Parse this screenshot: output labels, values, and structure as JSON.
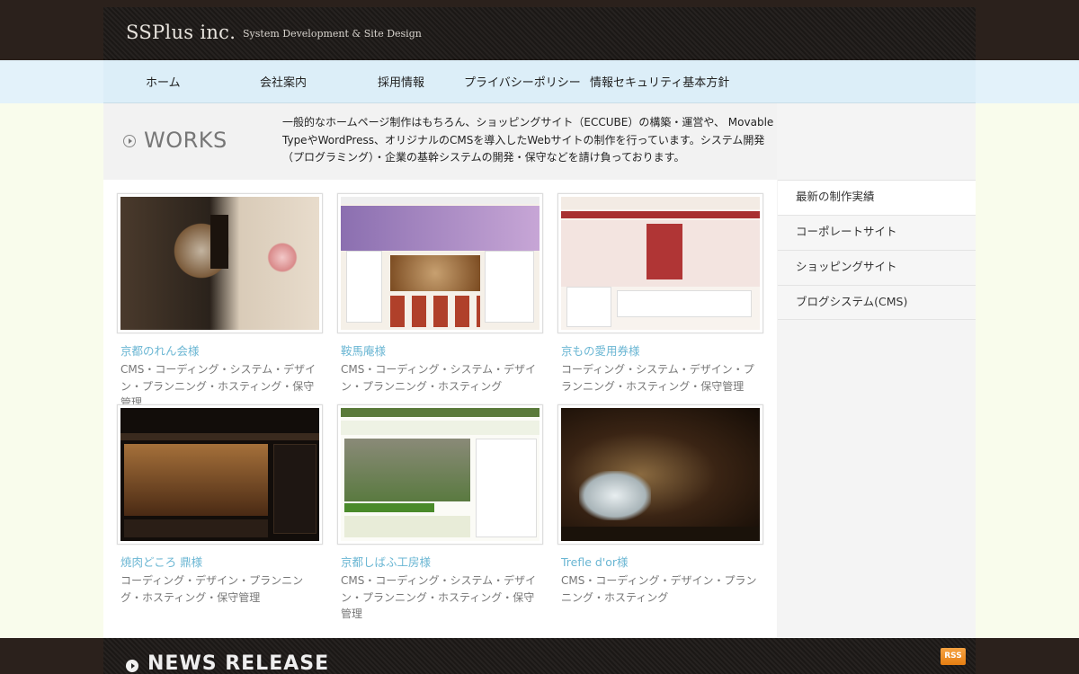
{
  "header": {
    "logo": "SSPlus inc.",
    "tagline": "System Development & Site Design"
  },
  "nav": {
    "items": [
      {
        "label": "ホーム"
      },
      {
        "label": "会社案内"
      },
      {
        "label": "採用情報"
      },
      {
        "label": "プライバシーポリシー"
      },
      {
        "label": "情報セキュリティ基本方針"
      }
    ]
  },
  "works": {
    "title": "WORKS",
    "description": "一般的なホームページ制作はもちろん、ショッピングサイト（ECCUBE）の構築・運営や、 Movable TypeやWordPress、オリジナルのCMSを導入したWebサイトの制作を行っています。システム開発（プログラミング）・企業の基幹システムの開発・保守などを請け負っております。",
    "items": [
      {
        "name": "京都のれん会様",
        "tags": "CMS・コーディング・システム・デザイン・プランニング・ホスティング・保守管理"
      },
      {
        "name": "鞍馬庵様",
        "tags": "CMS・コーディング・システム・デザイン・プランニング・ホスティング"
      },
      {
        "name": "京もの愛用券様",
        "tags": "コーディング・システム・デザイン・プランニング・ホスティング・保守管理"
      },
      {
        "name": "焼肉どころ 鼎様",
        "tags": "コーディング・デザイン・プランニング・ホスティング・保守管理"
      },
      {
        "name": "京都しばふ工房様",
        "tags": "CMS・コーディング・システム・デザイン・プランニング・ホスティング・保守管理"
      },
      {
        "name": "Trefle d'or様",
        "tags": "CMS・コーディング・デザイン・プランニング・ホスティング"
      }
    ]
  },
  "sidebar": {
    "items": [
      {
        "label": "最新の制作実績"
      },
      {
        "label": "コーポレートサイト"
      },
      {
        "label": "ショッピングサイト"
      },
      {
        "label": "ブログシステム(CMS)"
      }
    ]
  },
  "news": {
    "title": "NEWS RELEASE",
    "rss_label": "RSS"
  },
  "colors": {
    "accent_link": "#6ab6d3",
    "header_bg": "#1b1816",
    "nav_bg": "#dceef8"
  }
}
